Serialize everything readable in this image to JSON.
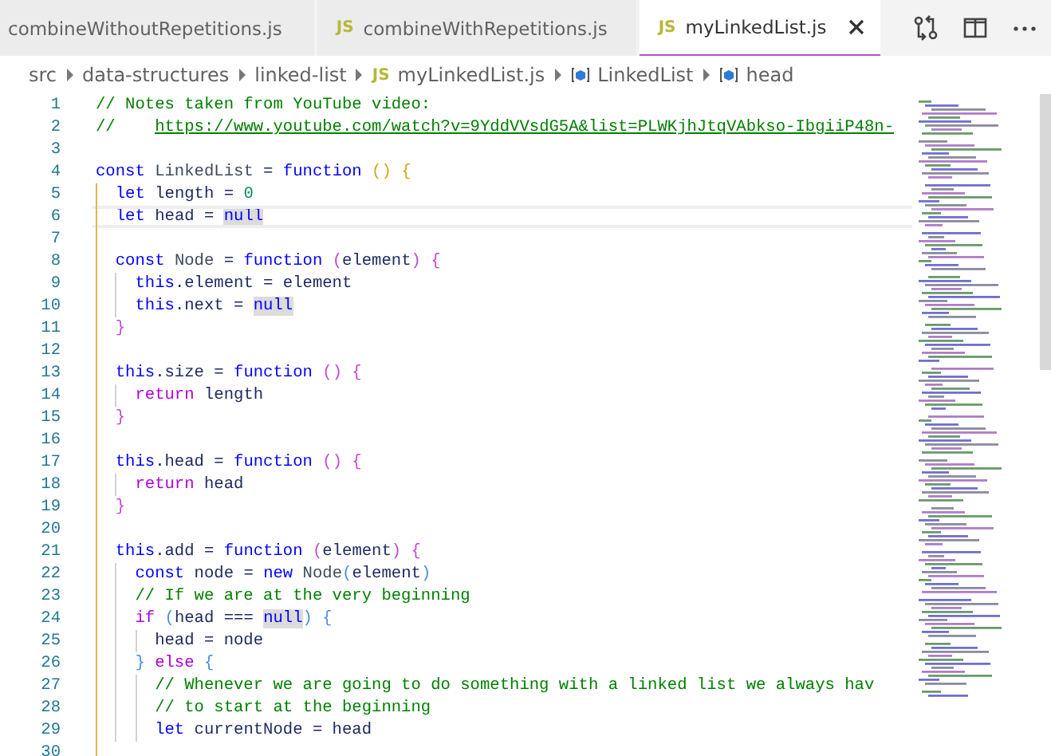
{
  "tabs": [
    {
      "label": "combineWithoutRepetitions.js",
      "selected": false
    },
    {
      "icon": "JS",
      "label": "combineWithRepetitions.js",
      "selected": false
    },
    {
      "icon": "JS",
      "label": "myLinkedList.js",
      "selected": true
    }
  ],
  "breadcrumb": [
    {
      "kind": "folder",
      "label": "src"
    },
    {
      "kind": "folder",
      "label": "data-structures"
    },
    {
      "kind": "folder",
      "label": "linked-list"
    },
    {
      "kind": "file",
      "icon": "JS",
      "label": "myLinkedList.js"
    },
    {
      "kind": "symbol",
      "label": "LinkedList"
    },
    {
      "kind": "symbol",
      "label": "head"
    }
  ],
  "editor": {
    "lines": [
      {
        "number": "1",
        "current": false,
        "tokens": [
          {
            "kind": "comment",
            "text": "// Notes taken from YouTube video:"
          }
        ]
      },
      {
        "number": "2",
        "current": false,
        "tokens": [
          {
            "kind": "comment",
            "text": "//    "
          },
          {
            "kind": "link",
            "text": "https://www.youtube.com/watch?v=9YddVVsdG5A&list=PLWKjhJtqVAbkso-IbgiiP48n-"
          }
        ]
      },
      {
        "number": "3",
        "current": false
      },
      {
        "number": "4",
        "current": false,
        "tokens": [
          {
            "kind": "keyword",
            "text": "const "
          },
          {
            "kind": "class",
            "text": "LinkedList"
          },
          {
            "kind": "plain",
            "text": " = "
          },
          {
            "kind": "keyword",
            "text": "function "
          },
          {
            "kind": "bracket1",
            "text": "() {"
          }
        ]
      },
      {
        "number": "5",
        "current": false,
        "tokens": [
          {
            "kind": "keyword",
            "text": "  let"
          },
          {
            "kind": "plain",
            "text": " length = "
          },
          {
            "kind": "number",
            "text": "0"
          }
        ]
      },
      {
        "number": "6",
        "current": true,
        "tokens": [
          {
            "kind": "keyword",
            "text": "  let"
          },
          {
            "kind": "plain",
            "text": " head = "
          },
          {
            "kind": "null",
            "text": "null",
            "highlighted": true
          }
        ]
      },
      {
        "number": "7",
        "current": false
      },
      {
        "number": "8",
        "current": false,
        "tokens": [
          {
            "kind": "keyword",
            "text": "  const "
          },
          {
            "kind": "class",
            "text": "Node"
          },
          {
            "kind": "plain",
            "text": " = "
          },
          {
            "kind": "keyword",
            "text": "function "
          },
          {
            "kind": "bracket2",
            "text": "("
          },
          {
            "kind": "plain",
            "text": "element"
          },
          {
            "kind": "bracket2",
            "text": ") {"
          }
        ]
      },
      {
        "number": "9",
        "current": false,
        "tokens": [
          {
            "kind": "keyword",
            "text": "    this"
          },
          {
            "kind": "plain",
            "text": ".element = element"
          }
        ]
      },
      {
        "number": "10",
        "current": false,
        "tokens": [
          {
            "kind": "keyword",
            "text": "    this"
          },
          {
            "kind": "plain",
            "text": ".next = "
          },
          {
            "kind": "null",
            "text": "null",
            "highlighted": true
          }
        ]
      },
      {
        "number": "11",
        "current": false,
        "tokens": [
          {
            "kind": "bracket2",
            "text": "  }"
          }
        ]
      },
      {
        "number": "12",
        "current": false
      },
      {
        "number": "13",
        "current": false,
        "tokens": [
          {
            "kind": "keyword",
            "text": "  this"
          },
          {
            "kind": "plain",
            "text": ".size = "
          },
          {
            "kind": "keyword",
            "text": "function "
          },
          {
            "kind": "bracket2",
            "text": "() {"
          }
        ]
      },
      {
        "number": "14",
        "current": false,
        "tokens": [
          {
            "kind": "control",
            "text": "    return"
          },
          {
            "kind": "plain",
            "text": " length"
          }
        ]
      },
      {
        "number": "15",
        "current": false,
        "tokens": [
          {
            "kind": "bracket2",
            "text": "  }"
          }
        ]
      },
      {
        "number": "16",
        "current": false
      },
      {
        "number": "17",
        "current": false,
        "tokens": [
          {
            "kind": "keyword",
            "text": "  this"
          },
          {
            "kind": "plain",
            "text": ".head = "
          },
          {
            "kind": "keyword",
            "text": "function "
          },
          {
            "kind": "bracket2",
            "text": "() {"
          }
        ]
      },
      {
        "number": "18",
        "current": false,
        "tokens": [
          {
            "kind": "control",
            "text": "    return"
          },
          {
            "kind": "plain",
            "text": " head"
          }
        ]
      },
      {
        "number": "19",
        "current": false,
        "tokens": [
          {
            "kind": "bracket2",
            "text": "  }"
          }
        ]
      },
      {
        "number": "20",
        "current": false
      },
      {
        "number": "21",
        "current": false,
        "tokens": [
          {
            "kind": "keyword",
            "text": "  this"
          },
          {
            "kind": "plain",
            "text": ".add = "
          },
          {
            "kind": "keyword",
            "text": "function "
          },
          {
            "kind": "bracket2",
            "text": "("
          },
          {
            "kind": "plain",
            "text": "element"
          },
          {
            "kind": "bracket2",
            "text": ") {"
          }
        ]
      },
      {
        "number": "22",
        "current": false,
        "tokens": [
          {
            "kind": "keyword",
            "text": "    const"
          },
          {
            "kind": "plain",
            "text": " node = "
          },
          {
            "kind": "keyword",
            "text": "new "
          },
          {
            "kind": "class",
            "text": "Node"
          },
          {
            "kind": "bracket3",
            "text": "("
          },
          {
            "kind": "plain",
            "text": "element"
          },
          {
            "kind": "bracket3",
            "text": ")"
          }
        ]
      },
      {
        "number": "23",
        "current": false,
        "tokens": [
          {
            "kind": "comment",
            "text": "    // If we are at the very beginning"
          }
        ]
      },
      {
        "number": "24",
        "current": false,
        "tokens": [
          {
            "kind": "control",
            "text": "    if "
          },
          {
            "kind": "bracket3",
            "text": "("
          },
          {
            "kind": "plain",
            "text": "head === "
          },
          {
            "kind": "null",
            "text": "null",
            "highlighted": true
          },
          {
            "kind": "bracket3",
            "text": ") {"
          }
        ]
      },
      {
        "number": "25",
        "current": false,
        "tokens": [
          {
            "kind": "plain",
            "text": "      head = node"
          }
        ]
      },
      {
        "number": "26",
        "current": false,
        "tokens": [
          {
            "kind": "bracket3",
            "text": "    } "
          },
          {
            "kind": "control",
            "text": "else "
          },
          {
            "kind": "bracket3",
            "text": "{"
          }
        ]
      },
      {
        "number": "27",
        "current": false,
        "tokens": [
          {
            "kind": "comment",
            "text": "      // Whenever we are going to do something with a linked list we always hav"
          }
        ]
      },
      {
        "number": "28",
        "current": false,
        "tokens": [
          {
            "kind": "comment",
            "text": "      // to start at the beginning"
          }
        ]
      },
      {
        "number": "29",
        "current": false,
        "tokens": [
          {
            "kind": "keyword",
            "text": "      let"
          },
          {
            "kind": "plain",
            "text": " currentNode = head"
          }
        ]
      },
      {
        "number": "30",
        "current": false
      }
    ]
  }
}
